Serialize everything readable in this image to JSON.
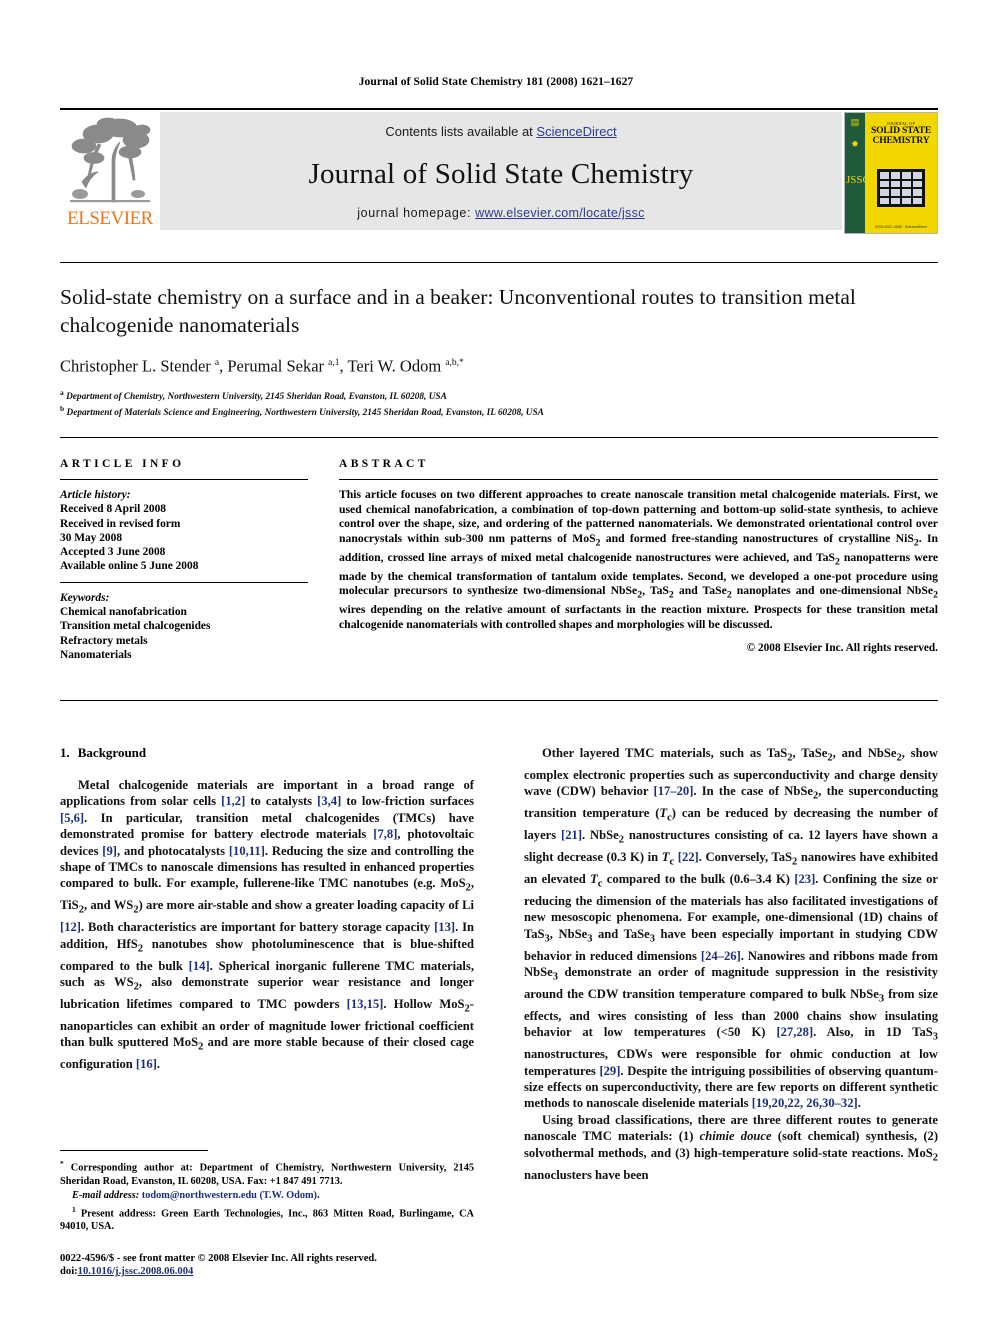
{
  "running_head": "Journal of Solid State Chemistry 181 (2008) 1621–1627",
  "masthead": {
    "contents_prefix": "Contents lists available at ",
    "sciencedirect": "ScienceDirect",
    "journal_title": "Journal of Solid State Chemistry",
    "homepage_prefix": "journal homepage: ",
    "homepage_url": "www.elsevier.com/locate/jssc",
    "publisher_wordmark": "ELSEVIER",
    "cover": {
      "kicker": "JOURNAL OF",
      "line1": "SOLID STATE",
      "line2": "CHEMISTRY",
      "spine_text": "JSSC",
      "footer": "ISSN 0022-4596 · ScienceDirect"
    },
    "link_color": "#2b3c8f",
    "band_color": "#e6e6e6",
    "elsevier_orange": "#e87722"
  },
  "title_block": {
    "title": "Solid-state chemistry on a surface and in a beaker: Unconventional routes to transition metal chalcogenide nanomaterials",
    "authors_html": "Christopher L. Stender <sup>a</sup>, Perumal Sekar <sup>a,1</sup>, Teri W. Odom <sup>a,b,*</sup>",
    "affiliations": [
      {
        "mark": "a",
        "text": "Department of Chemistry, Northwestern University, 2145 Sheridan Road, Evanston, IL 60208, USA"
      },
      {
        "mark": "b",
        "text": "Department of Materials Science and Engineering, Northwestern University, 2145 Sheridan Road, Evanston, IL 60208, USA"
      }
    ]
  },
  "article_info": {
    "heading": "ARTICLE INFO",
    "history_label": "Article history:",
    "history": [
      "Received 8 April 2008",
      "Received in revised form",
      "30 May 2008",
      "Accepted 3 June 2008",
      "Available online 5 June 2008"
    ],
    "keywords_label": "Keywords:",
    "keywords": [
      "Chemical nanofabrication",
      "Transition metal chalcogenides",
      "Refractory metals",
      "Nanomaterials"
    ]
  },
  "abstract": {
    "heading": "ABSTRACT",
    "text_html": "This article focuses on two different approaches to create nanoscale transition metal chalcogenide materials. First, we used chemical nanofabrication, a combination of top-down patterning and bottom-up solid-state synthesis, to achieve control over the shape, size, and ordering of the patterned nanomaterials. We demonstrated orientational control over nanocrystals within sub-300 nm patterns of MoS<sub>2</sub> and formed free-standing nanostructures of crystalline NiS<sub>2</sub>. In addition, crossed line arrays of mixed metal chalcogenide nanostructures were achieved, and TaS<sub>2</sub> nanopatterns were made by the chemical transformation of tantalum oxide templates. Second, we developed a one-pot procedure using molecular precursors to synthesize two-dimensional NbSe<sub>2</sub>, TaS<sub>2</sub> and TaSe<sub>2</sub> nanoplates and one-dimensional NbSe<sub>2</sub> wires depending on the relative amount of surfactants in the reaction mixture. Prospects for these transition metal chalcogenide nanomaterials with controlled shapes and morphologies will be discussed.",
    "copyright": "© 2008 Elsevier Inc. All rights reserved."
  },
  "body": {
    "section_number": "1.",
    "section_title": "Background",
    "left_paragraphs_html": [
      "Metal chalcogenide materials are important in a broad range of applications from solar cells <span class=\"cite\">[1,2]</span> to catalysts <span class=\"cite\">[3,4]</span> to low-friction surfaces <span class=\"cite\">[5,6]</span>. In particular, transition metal chalcogenides (TMCs) have demonstrated promise for battery electrode materials <span class=\"cite\">[7,8]</span>, photovoltaic devices <span class=\"cite\">[9]</span>, and photocatalysts <span class=\"cite\">[10,11]</span>. Reducing the size and controlling the shape of TMCs to nanoscale dimensions has resulted in enhanced properties compared to bulk. For example, fullerene-like TMC nanotubes (e.g. MoS<sub>2</sub>, TiS<sub>2</sub>, and WS<sub>2</sub>) are more air-stable and show a greater loading capacity of Li <span class=\"cite\">[12]</span>. Both characteristics are important for battery storage capacity <span class=\"cite\">[13]</span>. In addition, HfS<sub>2</sub> nanotubes show photoluminescence that is blue-shifted compared to the bulk <span class=\"cite\">[14]</span>. Spherical inorganic fullerene TMC materials, such as WS<sub>2</sub>, also demonstrate superior wear resistance and longer lubrication lifetimes compared to TMC powders <span class=\"cite\">[13,15]</span>. Hollow MoS<sub>2</sub>-nanoparticles can exhibit an order of magnitude lower frictional coefficient than bulk sputtered MoS<sub>2</sub> and are more stable because of their closed cage configuration <span class=\"cite\">[16]</span>."
    ],
    "right_paragraphs_html": [
      "Other layered TMC materials, such as TaS<sub>2</sub>, TaSe<sub>2</sub>, and NbSe<sub>2</sub>, show complex electronic properties such as superconductivity and charge density wave (CDW) behavior <span class=\"cite\">[17–20]</span>. In the case of NbSe<sub>2</sub>, the superconducting transition temperature (<span class=\"it\">T</span><sub>c</sub>) can be reduced by decreasing the number of layers <span class=\"cite\">[21]</span>. NbSe<sub>2</sub> nanostructures consisting of ca. 12 layers have shown a slight decrease (0.3 K) in <span class=\"it\">T</span><sub>c</sub> <span class=\"cite\">[22]</span>. Conversely, TaS<sub>2</sub> nanowires have exhibited an elevated <span class=\"it\">T</span><sub>c</sub> compared to the bulk (0.6–3.4 K) <span class=\"cite\">[23]</span>. Confining the size or reducing the dimension of the materials has also facilitated investigations of new mesoscopic phenomena. For example, one-dimensional (1D) chains of TaS<sub>3</sub>, NbSe<sub>3</sub> and TaSe<sub>3</sub> have been especially important in studying CDW behavior in reduced dimensions <span class=\"cite\">[24–26]</span>. Nanowires and ribbons made from NbSe<sub>3</sub> demonstrate an order of magnitude suppression in the resistivity around the CDW transition temperature compared to bulk NbSe<sub>3</sub> from size effects, and wires consisting of less than 2000 chains show insulating behavior at low temperatures (&lt;50 K) <span class=\"cite\">[27,28]</span>. Also, in 1D TaS<sub>3</sub> nanostructures, CDWs were responsible for ohmic conduction at low temperatures <span class=\"cite\">[29]</span>. Despite the intriguing possibilities of observing quantum-size effects on superconductivity, there are few reports on different synthetic methods to nanoscale diselenide materials <span class=\"cite\">[19,20,22, 26,30–32]</span>.",
      "Using broad classifications, there are three different routes to generate nanoscale TMC materials: (1) <span class=\"it\">chimie douce</span> (soft chemical) synthesis, (2) solvothermal methods, and (3) high-temperature solid-state reactions. MoS<sub>2</sub> nanoclusters have been"
    ]
  },
  "footnotes": {
    "corresponding_html": "<span class=\"fn-sup\">*</span> Corresponding author at: Department of Chemistry, Northwestern University, 2145 Sheridan Road, Evanston, IL 60208, USA. Fax: +1 847 491 7713.",
    "email_html": "<span class=\"it\">E-mail address:</span> <span class=\"mail-link\">todom@northwestern.edu (T.W. Odom)</span>.",
    "present_address_html": "<span class=\"fn-sup\">1</span> Present address: Green Earth Technologies, Inc., 863 Mitten Road, Burlingame, CA 94010, USA."
  },
  "imprint": {
    "line1_html": "0022-4596/$ - see front matter © 2008 Elsevier Inc. All rights reserved.",
    "line2_prefix": "doi:",
    "line2_doi": "10.1016/j.jssc.2008.06.004"
  }
}
